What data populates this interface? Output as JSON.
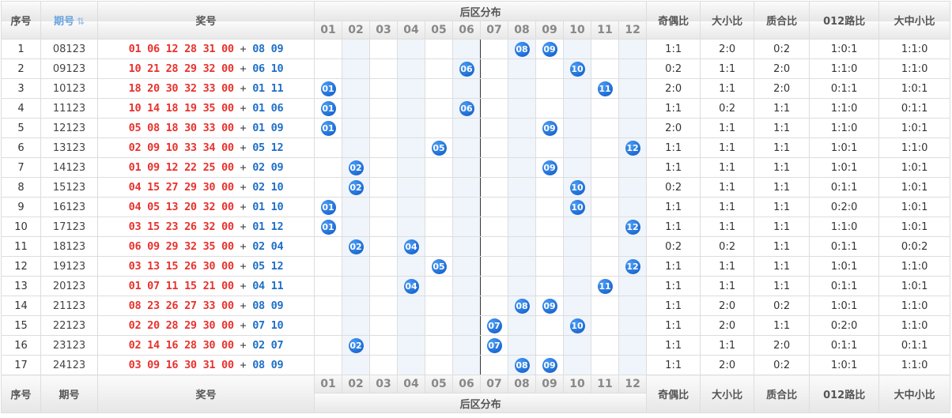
{
  "header": {
    "seq": "序号",
    "issue": "期号",
    "draw": "奖号",
    "dist_title": "后区分布",
    "cols": [
      "01",
      "02",
      "03",
      "04",
      "05",
      "06",
      "07",
      "08",
      "09",
      "10",
      "11",
      "12"
    ],
    "stats": [
      "奇偶比",
      "大小比",
      "质合比",
      "012路比",
      "大中小比"
    ]
  },
  "colors": {
    "front": "#e8322d",
    "back": "#1f6fc7",
    "ball": "#1565d8",
    "divider": "#333333"
  },
  "sort_icon": "sort-icon",
  "rows": [
    {
      "seq": "1",
      "issue": "08123",
      "front": "01 06 12 28 31 00",
      "back": "08 09",
      "balls": [
        "08",
        "09"
      ],
      "stats": [
        "1:1",
        "2:0",
        "0:2",
        "1:0:1",
        "1:1:0"
      ]
    },
    {
      "seq": "2",
      "issue": "09123",
      "front": "10 21 28 29 32 00",
      "back": "06 10",
      "balls": [
        "06",
        "10"
      ],
      "stats": [
        "0:2",
        "1:1",
        "2:0",
        "1:1:0",
        "1:1:0"
      ]
    },
    {
      "seq": "3",
      "issue": "10123",
      "front": "18 20 30 32 33 00",
      "back": "01 11",
      "balls": [
        "01",
        "11"
      ],
      "stats": [
        "2:0",
        "1:1",
        "2:0",
        "0:1:1",
        "1:0:1"
      ]
    },
    {
      "seq": "4",
      "issue": "11123",
      "front": "10 14 18 19 35 00",
      "back": "01 06",
      "balls": [
        "01",
        "06"
      ],
      "stats": [
        "1:1",
        "0:2",
        "1:1",
        "1:1:0",
        "0:1:1"
      ]
    },
    {
      "seq": "5",
      "issue": "12123",
      "front": "05 08 18 30 33 00",
      "back": "01 09",
      "balls": [
        "01",
        "09"
      ],
      "stats": [
        "2:0",
        "1:1",
        "1:1",
        "1:1:0",
        "1:0:1"
      ]
    },
    {
      "seq": "6",
      "issue": "13123",
      "front": "02 09 10 33 34 00",
      "back": "05 12",
      "balls": [
        "05",
        "12"
      ],
      "stats": [
        "1:1",
        "1:1",
        "1:1",
        "1:0:1",
        "1:1:0"
      ]
    },
    {
      "seq": "7",
      "issue": "14123",
      "front": "01 09 12 22 25 00",
      "back": "02 09",
      "balls": [
        "02",
        "09"
      ],
      "stats": [
        "1:1",
        "1:1",
        "1:1",
        "1:0:1",
        "1:0:1"
      ]
    },
    {
      "seq": "8",
      "issue": "15123",
      "front": "04 15 27 29 30 00",
      "back": "02 10",
      "balls": [
        "02",
        "10"
      ],
      "stats": [
        "0:2",
        "1:1",
        "1:1",
        "0:1:1",
        "1:0:1"
      ]
    },
    {
      "seq": "9",
      "issue": "16123",
      "front": "04 05 13 20 32 00",
      "back": "01 10",
      "balls": [
        "01",
        "10"
      ],
      "stats": [
        "1:1",
        "1:1",
        "1:1",
        "0:2:0",
        "1:0:1"
      ]
    },
    {
      "seq": "10",
      "issue": "17123",
      "front": "03 15 23 26 32 00",
      "back": "01 12",
      "balls": [
        "01",
        "12"
      ],
      "stats": [
        "1:1",
        "1:1",
        "1:1",
        "1:1:0",
        "1:0:1"
      ]
    },
    {
      "seq": "11",
      "issue": "18123",
      "front": "06 09 29 32 35 00",
      "back": "02 04",
      "balls": [
        "02",
        "04"
      ],
      "stats": [
        "0:2",
        "0:2",
        "1:1",
        "0:1:1",
        "0:0:2"
      ]
    },
    {
      "seq": "12",
      "issue": "19123",
      "front": "03 13 15 26 30 00",
      "back": "05 12",
      "balls": [
        "05",
        "12"
      ],
      "stats": [
        "1:1",
        "1:1",
        "1:1",
        "1:0:1",
        "1:1:0"
      ]
    },
    {
      "seq": "13",
      "issue": "20123",
      "front": "01 07 11 15 21 00",
      "back": "04 11",
      "balls": [
        "04",
        "11"
      ],
      "stats": [
        "1:1",
        "1:1",
        "1:1",
        "0:1:1",
        "1:0:1"
      ]
    },
    {
      "seq": "14",
      "issue": "21123",
      "front": "08 23 26 27 33 00",
      "back": "08 09",
      "balls": [
        "08",
        "09"
      ],
      "stats": [
        "1:1",
        "2:0",
        "0:2",
        "1:0:1",
        "1:1:0"
      ]
    },
    {
      "seq": "15",
      "issue": "22123",
      "front": "02 20 28 29 30 00",
      "back": "07 10",
      "balls": [
        "07",
        "10"
      ],
      "stats": [
        "1:1",
        "2:0",
        "1:1",
        "0:2:0",
        "1:1:0"
      ]
    },
    {
      "seq": "16",
      "issue": "23123",
      "front": "02 14 16 28 30 00",
      "back": "02 07",
      "balls": [
        "02",
        "07"
      ],
      "stats": [
        "1:1",
        "1:1",
        "2:0",
        "0:1:1",
        "0:1:1"
      ]
    },
    {
      "seq": "17",
      "issue": "24123",
      "front": "03 09 16 30 31 00",
      "back": "08 09",
      "balls": [
        "08",
        "09"
      ],
      "stats": [
        "1:1",
        "2:0",
        "0:2",
        "1:0:1",
        "1:1:0"
      ]
    }
  ]
}
